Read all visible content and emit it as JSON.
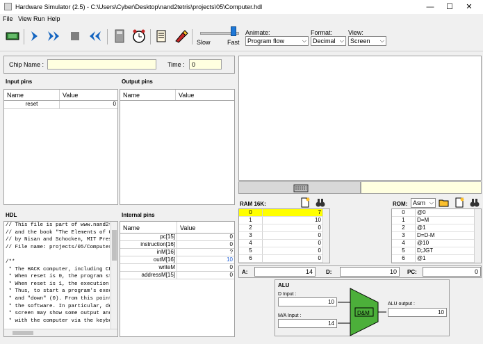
{
  "window": {
    "title": "Hardware Simulator (2.5) - C:\\Users\\Cyber\\Desktop\\nand2tetris\\projects\\05\\Computer.hdl",
    "min": "—",
    "max": "☐",
    "close": "✕"
  },
  "menu": [
    "File",
    "View",
    "Run",
    "Help"
  ],
  "toolbar": {
    "slow": "Slow",
    "fast": "Fast",
    "speed_level": 0.85,
    "animate_label": "Animate:",
    "animate_value": "Program flow",
    "format_label": "Format:",
    "format_value": "Decimal",
    "view_label": "View:",
    "view_value": "Screen"
  },
  "chip": {
    "name_label": "Chip Name :",
    "name_value": "",
    "time_label": "Time :",
    "time_value": "0"
  },
  "input_pins": {
    "title": "Input pins",
    "col_name": "Name",
    "col_value": "Value",
    "rows": [
      {
        "name": "reset",
        "value": "0"
      }
    ]
  },
  "output_pins": {
    "title": "Output pins",
    "col_name": "Name",
    "col_value": "Value"
  },
  "hdl": {
    "title": "HDL",
    "lines": [
      "// This file is part of www.nand2tetr",
      "// and the book \"The Elements of Comp",
      "// by Nisan and Schocken, MIT Press.",
      "// File name: projects/05/Computer.hd",
      "",
      "/**",
      " * The HACK computer, including CPU,",
      " * When reset is 0, the program store",
      " * When reset is 1, the execution of",
      " * Thus, to start a program's executi",
      " * and \"down\" (0). From this point on",
      " * the software. In particular, deper",
      " * screen may show some output and th",
      " * with the computer via the keyboarc"
    ]
  },
  "internal_pins": {
    "title": "Internal pins",
    "col_name": "Name",
    "col_value": "Value",
    "rows": [
      {
        "name": "pc[15]",
        "value": "0"
      },
      {
        "name": "instruction[16]",
        "value": "0"
      },
      {
        "name": "inM[16]",
        "value": "?"
      },
      {
        "name": "outM[16]",
        "value": "10"
      },
      {
        "name": "writeM",
        "value": "0"
      },
      {
        "name": "addressM[15]",
        "value": "0"
      }
    ]
  },
  "ram": {
    "title": "RAM 16K:",
    "rows": [
      {
        "addr": "0",
        "value": "7"
      },
      {
        "addr": "1",
        "value": "10"
      },
      {
        "addr": "2",
        "value": "0"
      },
      {
        "addr": "3",
        "value": "0"
      },
      {
        "addr": "4",
        "value": "0"
      },
      {
        "addr": "5",
        "value": "0"
      },
      {
        "addr": "6",
        "value": "0"
      }
    ]
  },
  "rom": {
    "title": "ROM:",
    "format": "Asm",
    "rows": [
      {
        "addr": "0",
        "value": "@0"
      },
      {
        "addr": "1",
        "value": "D=M"
      },
      {
        "addr": "2",
        "value": "@1"
      },
      {
        "addr": "3",
        "value": "D=D-M"
      },
      {
        "addr": "4",
        "value": "@10"
      },
      {
        "addr": "5",
        "value": "D;JGT"
      },
      {
        "addr": "6",
        "value": "@1"
      }
    ]
  },
  "registers": {
    "a_label": "A:",
    "a_value": "14",
    "d_label": "D:",
    "d_value": "10",
    "pc_label": "PC:",
    "pc_value": "0"
  },
  "alu": {
    "title": "ALU",
    "d_input_label": "D Input :",
    "d_input_value": "10",
    "ma_input_label": "M/A Input :",
    "ma_input_value": "14",
    "op": "D&M",
    "output_label": "ALU output :",
    "output_value": "10",
    "color": "#4caf3a"
  }
}
